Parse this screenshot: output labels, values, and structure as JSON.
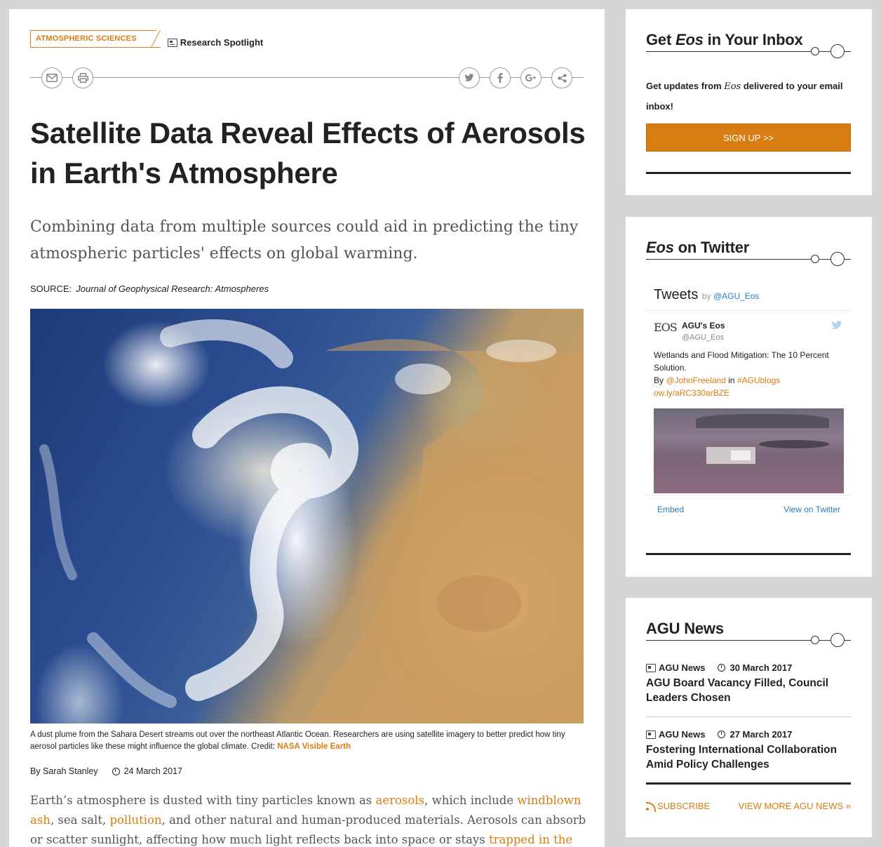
{
  "article": {
    "category": "ATMOSPHERIC SCIENCES",
    "type_label": "Research Spotlight",
    "title": "Satellite Data Reveal Effects of Aerosols in Earth's Atmosphere",
    "dek": "Combining data from multiple sources could aid in predicting the tiny atmospheric particles' effects on global warming.",
    "source_label": "SOURCE:",
    "source_name": "Journal of Geophysical Research: Atmospheres",
    "caption_text": "A dust plume from the Sahara Desert streams out over the northeast Atlantic Ocean. Researchers are using satellite imagery to better predict how tiny aerosol particles like these might influence the global climate. Credit: ",
    "caption_credit": "NASA Visible Earth",
    "author": "By Sarah Stanley",
    "date": "24 March 2017",
    "body": {
      "t1": "Earth’s atmosphere is dusted with tiny particles known as ",
      "l1": "aerosols",
      "t2": ", which include ",
      "l2": "windblown ash",
      "t3": ", sea salt, ",
      "l3": "pollution",
      "t4": ", and other natural and human-produced materials. Aerosols can absorb or scatter sunlight, affecting how much light reflects back into space or stays ",
      "l4": "trapped in the"
    }
  },
  "share_icons": {
    "email": "email-icon",
    "print": "print-icon",
    "twitter": "twitter-icon",
    "facebook": "facebook-icon",
    "gplus": "google-plus-icon",
    "share": "share-icon"
  },
  "inbox": {
    "title_pre": "Get ",
    "title_em": "Eos",
    "title_post": " in Your Inbox",
    "text_pre": "Get updates from ",
    "text_em": "Eos",
    "text_post": " delivered to your email inbox!",
    "button": "SIGN UP >>"
  },
  "twitter": {
    "title_em": "Eos",
    "title_post": " on Twitter",
    "heading": "Tweets",
    "by": "by ",
    "handle_link": "@AGU_Eos",
    "logo_text": "EOS",
    "account_name": "AGU's Eos",
    "account_handle": "@AGU_Eos",
    "tweet_line1": "Wetlands and Flood Mitigation: The 10 Percent Solution.",
    "tweet_by": "By ",
    "tweet_mention": "@JohnFreeland",
    "tweet_in": " in ",
    "tweet_tag": "#AGUblogs",
    "tweet_link": "ow.ly/aRC330arBZE",
    "embed": "Embed",
    "view": "View on Twitter"
  },
  "agu_news": {
    "title": "AGU News",
    "items": [
      {
        "source": "AGU News",
        "date": "30 March 2017",
        "title": "AGU Board Vacancy Filled, Council Leaders Chosen"
      },
      {
        "source": "AGU News",
        "date": "27 March 2017",
        "title": "Fostering International Collaboration Amid Policy Challenges"
      }
    ],
    "subscribe": "SUBSCRIBE",
    "view_more": "VIEW MORE AGU NEWS »"
  },
  "colors": {
    "accent": "#d97c12",
    "twitter_blue": "#2b7bb9",
    "page_bg": "#d6d6d6"
  }
}
